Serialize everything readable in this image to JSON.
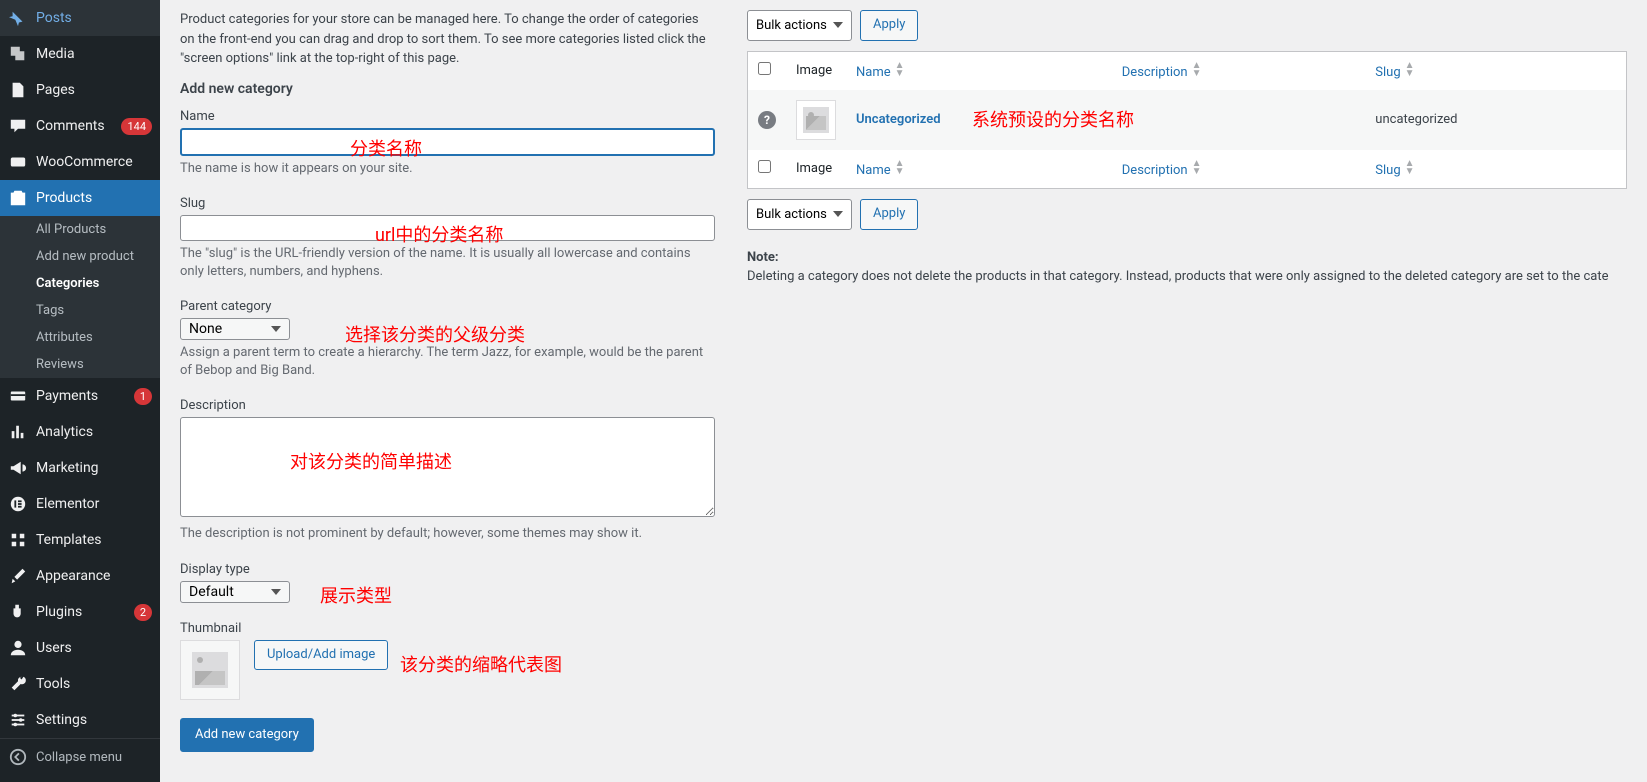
{
  "sidebar": {
    "items": [
      {
        "label": "Posts"
      },
      {
        "label": "Media"
      },
      {
        "label": "Pages"
      },
      {
        "label": "Comments",
        "badge": "144"
      },
      {
        "label": "WooCommerce"
      },
      {
        "label": "Products",
        "active": true
      },
      {
        "label": "Payments",
        "badge": "1"
      },
      {
        "label": "Analytics"
      },
      {
        "label": "Marketing"
      },
      {
        "label": "Elementor"
      },
      {
        "label": "Templates"
      },
      {
        "label": "Appearance"
      },
      {
        "label": "Plugins",
        "badge": "2"
      },
      {
        "label": "Users"
      },
      {
        "label": "Tools"
      },
      {
        "label": "Settings"
      }
    ],
    "submenu": {
      "items": [
        "All Products",
        "Add new product",
        "Categories",
        "Tags",
        "Attributes",
        "Reviews"
      ],
      "current": "Categories"
    },
    "collapse": "Collapse menu"
  },
  "intro": "Product categories for your store can be managed here. To change the order of categories on the front-end you can drag and drop to sort them. To see more categories listed click the \"screen options\" link at the top-right of this page.",
  "form": {
    "heading": "Add new category",
    "name_label": "Name",
    "name_help": "The name is how it appears on your site.",
    "slug_label": "Slug",
    "slug_help": "The \"slug\" is the URL-friendly version of the name. It is usually all lowercase and contains only letters, numbers, and hyphens.",
    "parent_label": "Parent category",
    "parent_value": "None",
    "parent_help": "Assign a parent term to create a hierarchy. The term Jazz, for example, would be the parent of Bebop and Big Band.",
    "desc_label": "Description",
    "desc_help": "The description is not prominent by default; however, some themes may show it.",
    "display_label": "Display type",
    "display_value": "Default",
    "thumb_label": "Thumbnail",
    "upload_btn": "Upload/Add image",
    "submit": "Add new category"
  },
  "annotations": {
    "name": "分类名称",
    "slug": "url中的分类名称",
    "parent": "选择该分类的父级分类",
    "desc": "对该分类的简单描述",
    "display": "展示类型",
    "thumb": "该分类的缩略代表图",
    "row": "系统预设的分类名称"
  },
  "table": {
    "bulk": "Bulk actions",
    "apply": "Apply",
    "cols": {
      "image": "Image",
      "name": "Name",
      "desc": "Description",
      "slug": "Slug"
    },
    "row": {
      "name": "Uncategorized",
      "slug": "uncategorized"
    },
    "note_h": "Note:",
    "note": "Deleting a category does not delete the products in that category. Instead, products that were only assigned to the deleted category are set to the cate"
  }
}
